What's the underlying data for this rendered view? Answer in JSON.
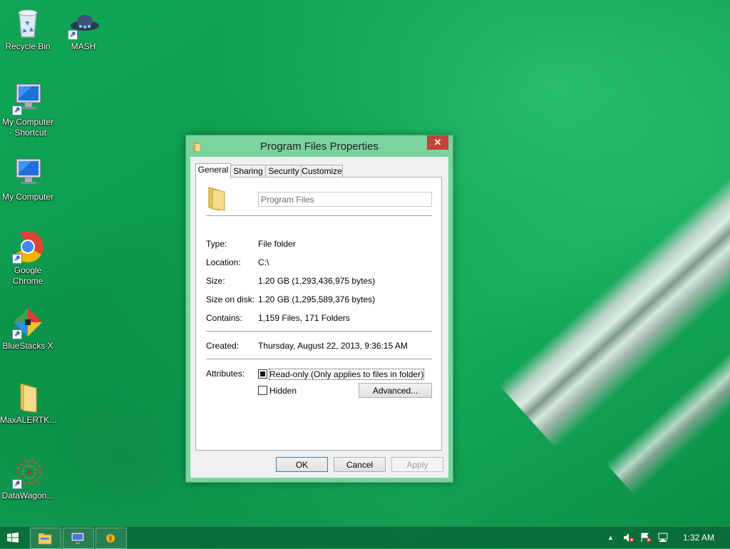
{
  "desktop": {
    "icons": [
      {
        "label": "Recycle Bin",
        "icon": "recycle-bin-icon"
      },
      {
        "label": "MASH",
        "icon": "mash-icon"
      },
      {
        "label": "My Computer - Shortcut",
        "icon": "computer-shortcut-icon"
      },
      {
        "label": "My Computer",
        "icon": "computer-icon"
      },
      {
        "label": "Google Chrome",
        "icon": "chrome-icon"
      },
      {
        "label": "BlueStacks X",
        "icon": "bluestacks-icon"
      },
      {
        "label": "MaxALERTK...",
        "icon": "folder-icon"
      },
      {
        "label": "DataWagon...",
        "icon": "datawagon-icon"
      }
    ]
  },
  "dialog": {
    "title": "Program Files Properties",
    "close_label": "✕",
    "tabs": [
      "General",
      "Sharing",
      "Security",
      "Customize"
    ],
    "active_tab": "General",
    "name": "Program Files",
    "fields": [
      {
        "label": "Type:",
        "value": "File folder"
      },
      {
        "label": "Location:",
        "value": "C:\\"
      },
      {
        "label": "Size:",
        "value": "1.20 GB (1,293,436,975 bytes)"
      },
      {
        "label": "Size on disk:",
        "value": "1.20 GB (1,295,589,376 bytes)"
      },
      {
        "label": "Contains:",
        "value": "1,159 Files, 171 Folders"
      }
    ],
    "created": {
      "label": "Created:",
      "value": "Thursday, August 22, 2013, 9:36:15 AM"
    },
    "attributes": {
      "label": "Attributes:",
      "readonly": "Read-only (Only applies to files in folder)",
      "readonly_state": "indeterminate",
      "hidden": "Hidden",
      "hidden_state": "unchecked",
      "advanced": "Advanced..."
    },
    "buttons": {
      "ok": "OK",
      "cancel": "Cancel",
      "apply": "Apply"
    }
  },
  "taskbar": {
    "clock": "1:32 AM",
    "tray_chevron": "▲"
  },
  "colors": {
    "dialog_frame": "#7bd3a0",
    "close": "#c7403a",
    "desktop": "#10a656"
  }
}
